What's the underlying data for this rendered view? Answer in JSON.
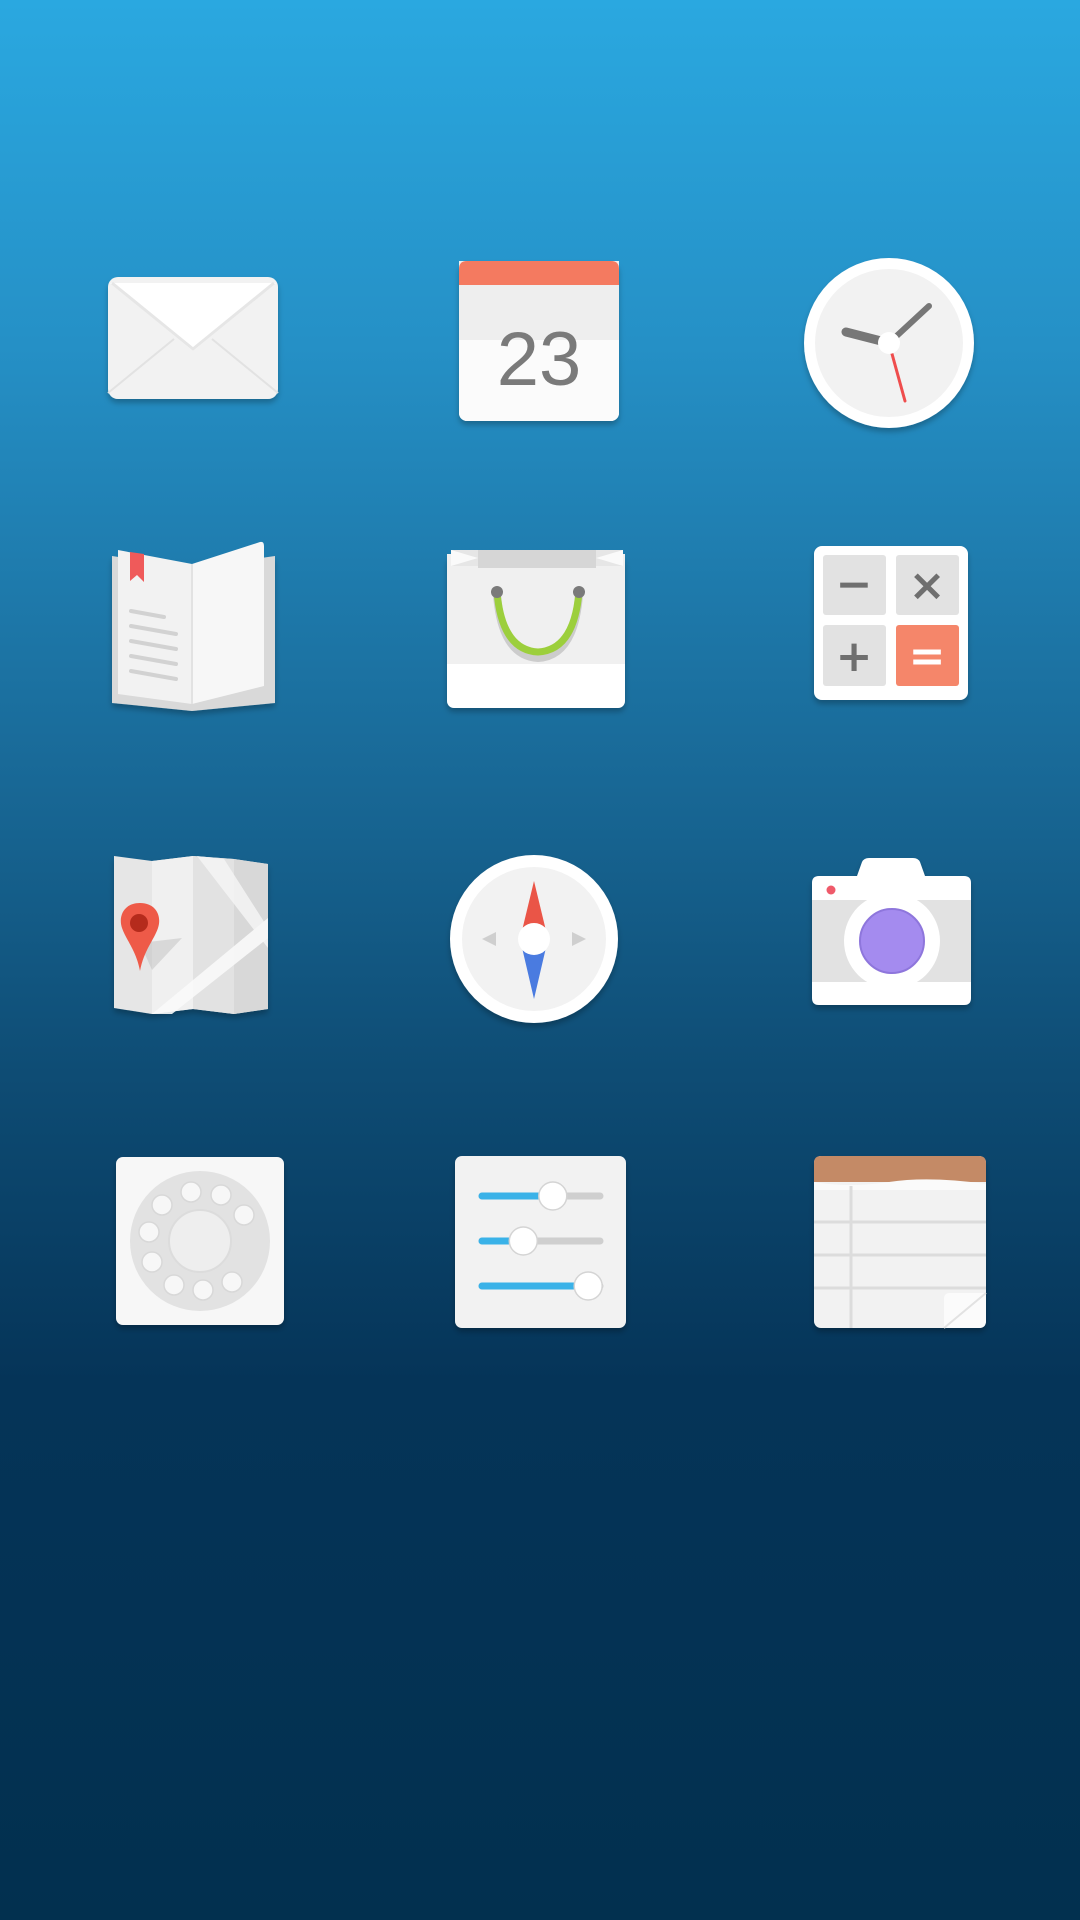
{
  "home_screen": {
    "background": {
      "top_color": "#2aa8e0",
      "bottom_color": "#02304f"
    },
    "icons": [
      {
        "name": "mail-icon",
        "label": "",
        "colors": {
          "body": "#f2f2f2",
          "flap": "#e4e4e4"
        }
      },
      {
        "name": "calendar-icon",
        "label": "",
        "date_text": "23",
        "colors": {
          "header": "#f47a60",
          "page": "#f4f4f4",
          "digits": "#7a7a7a"
        }
      },
      {
        "name": "clock-icon",
        "label": "",
        "colors": {
          "face": "#f2f2f2",
          "hands": "#777777",
          "second_hand": "#ef4d4d"
        }
      },
      {
        "name": "books-icon",
        "label": "",
        "colors": {
          "pages": "#f2f2f2",
          "bookmark": "#ef5a5a"
        }
      },
      {
        "name": "store-bag-icon",
        "label": "",
        "colors": {
          "bag": "#f2f2f2",
          "handle": "#9ccf3c"
        }
      },
      {
        "name": "calculator-icon",
        "label": "",
        "keys": [
          "−",
          "×",
          "+",
          "="
        ],
        "colors": {
          "keys": "#e2e2e2",
          "equals": "#f5866a",
          "symbols": "#6f6f6f"
        }
      },
      {
        "name": "maps-icon",
        "label": "",
        "colors": {
          "map": "#dedede",
          "pin": "#ee5a48"
        }
      },
      {
        "name": "compass-icon",
        "label": "",
        "colors": {
          "north_needle": "#ea5547",
          "south_needle": "#4a7be0"
        }
      },
      {
        "name": "camera-icon",
        "label": "",
        "colors": {
          "lens": "#a48bef",
          "body": "#f2f2f2",
          "indicator": "#ef5a6a"
        }
      },
      {
        "name": "phone-dial-icon",
        "label": "",
        "colors": {
          "dial": "#e2e2e2",
          "holes": "#f7f7f7"
        }
      },
      {
        "name": "settings-sliders-icon",
        "label": "",
        "slider_levels": [
          0.6,
          0.35,
          0.9
        ],
        "colors": {
          "track_active": "#3ab2e8",
          "track": "#cfcfcf",
          "knob": "#ffffff"
        }
      },
      {
        "name": "notes-icon",
        "label": "",
        "colors": {
          "header": "#c48a66",
          "paper": "#f2f2f2",
          "lines": "#dcdcdc"
        }
      }
    ]
  }
}
